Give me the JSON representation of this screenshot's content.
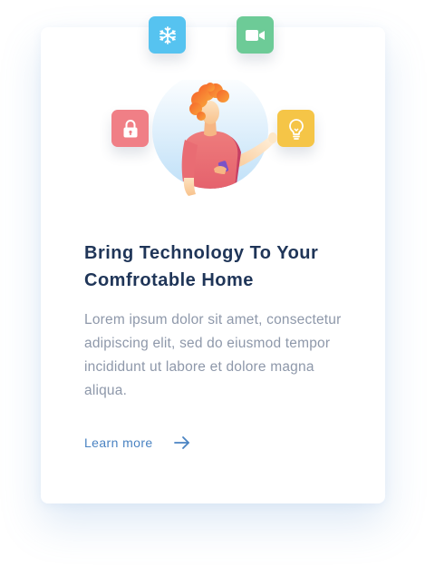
{
  "card": {
    "title": "Bring Technology To Your Comfrotable Home",
    "description": "Lorem ipsum dolor sit amet, consectetur adipiscing elit, sed do eiusmod tempor incididunt ut labore et dolore magna aliqua.",
    "link_label": "Learn more"
  },
  "icons": {
    "snowflake": {
      "name": "snowflake-icon",
      "color": "#56c3f0"
    },
    "video": {
      "name": "video-camera-icon",
      "color": "#6dcb97"
    },
    "lock": {
      "name": "lock-icon",
      "color": "#f07f86"
    },
    "bulb": {
      "name": "lightbulb-icon",
      "color": "#f5c547"
    }
  },
  "colors": {
    "title": "#1f3558",
    "body_text": "#8e98aa",
    "link": "#4a83c2"
  }
}
